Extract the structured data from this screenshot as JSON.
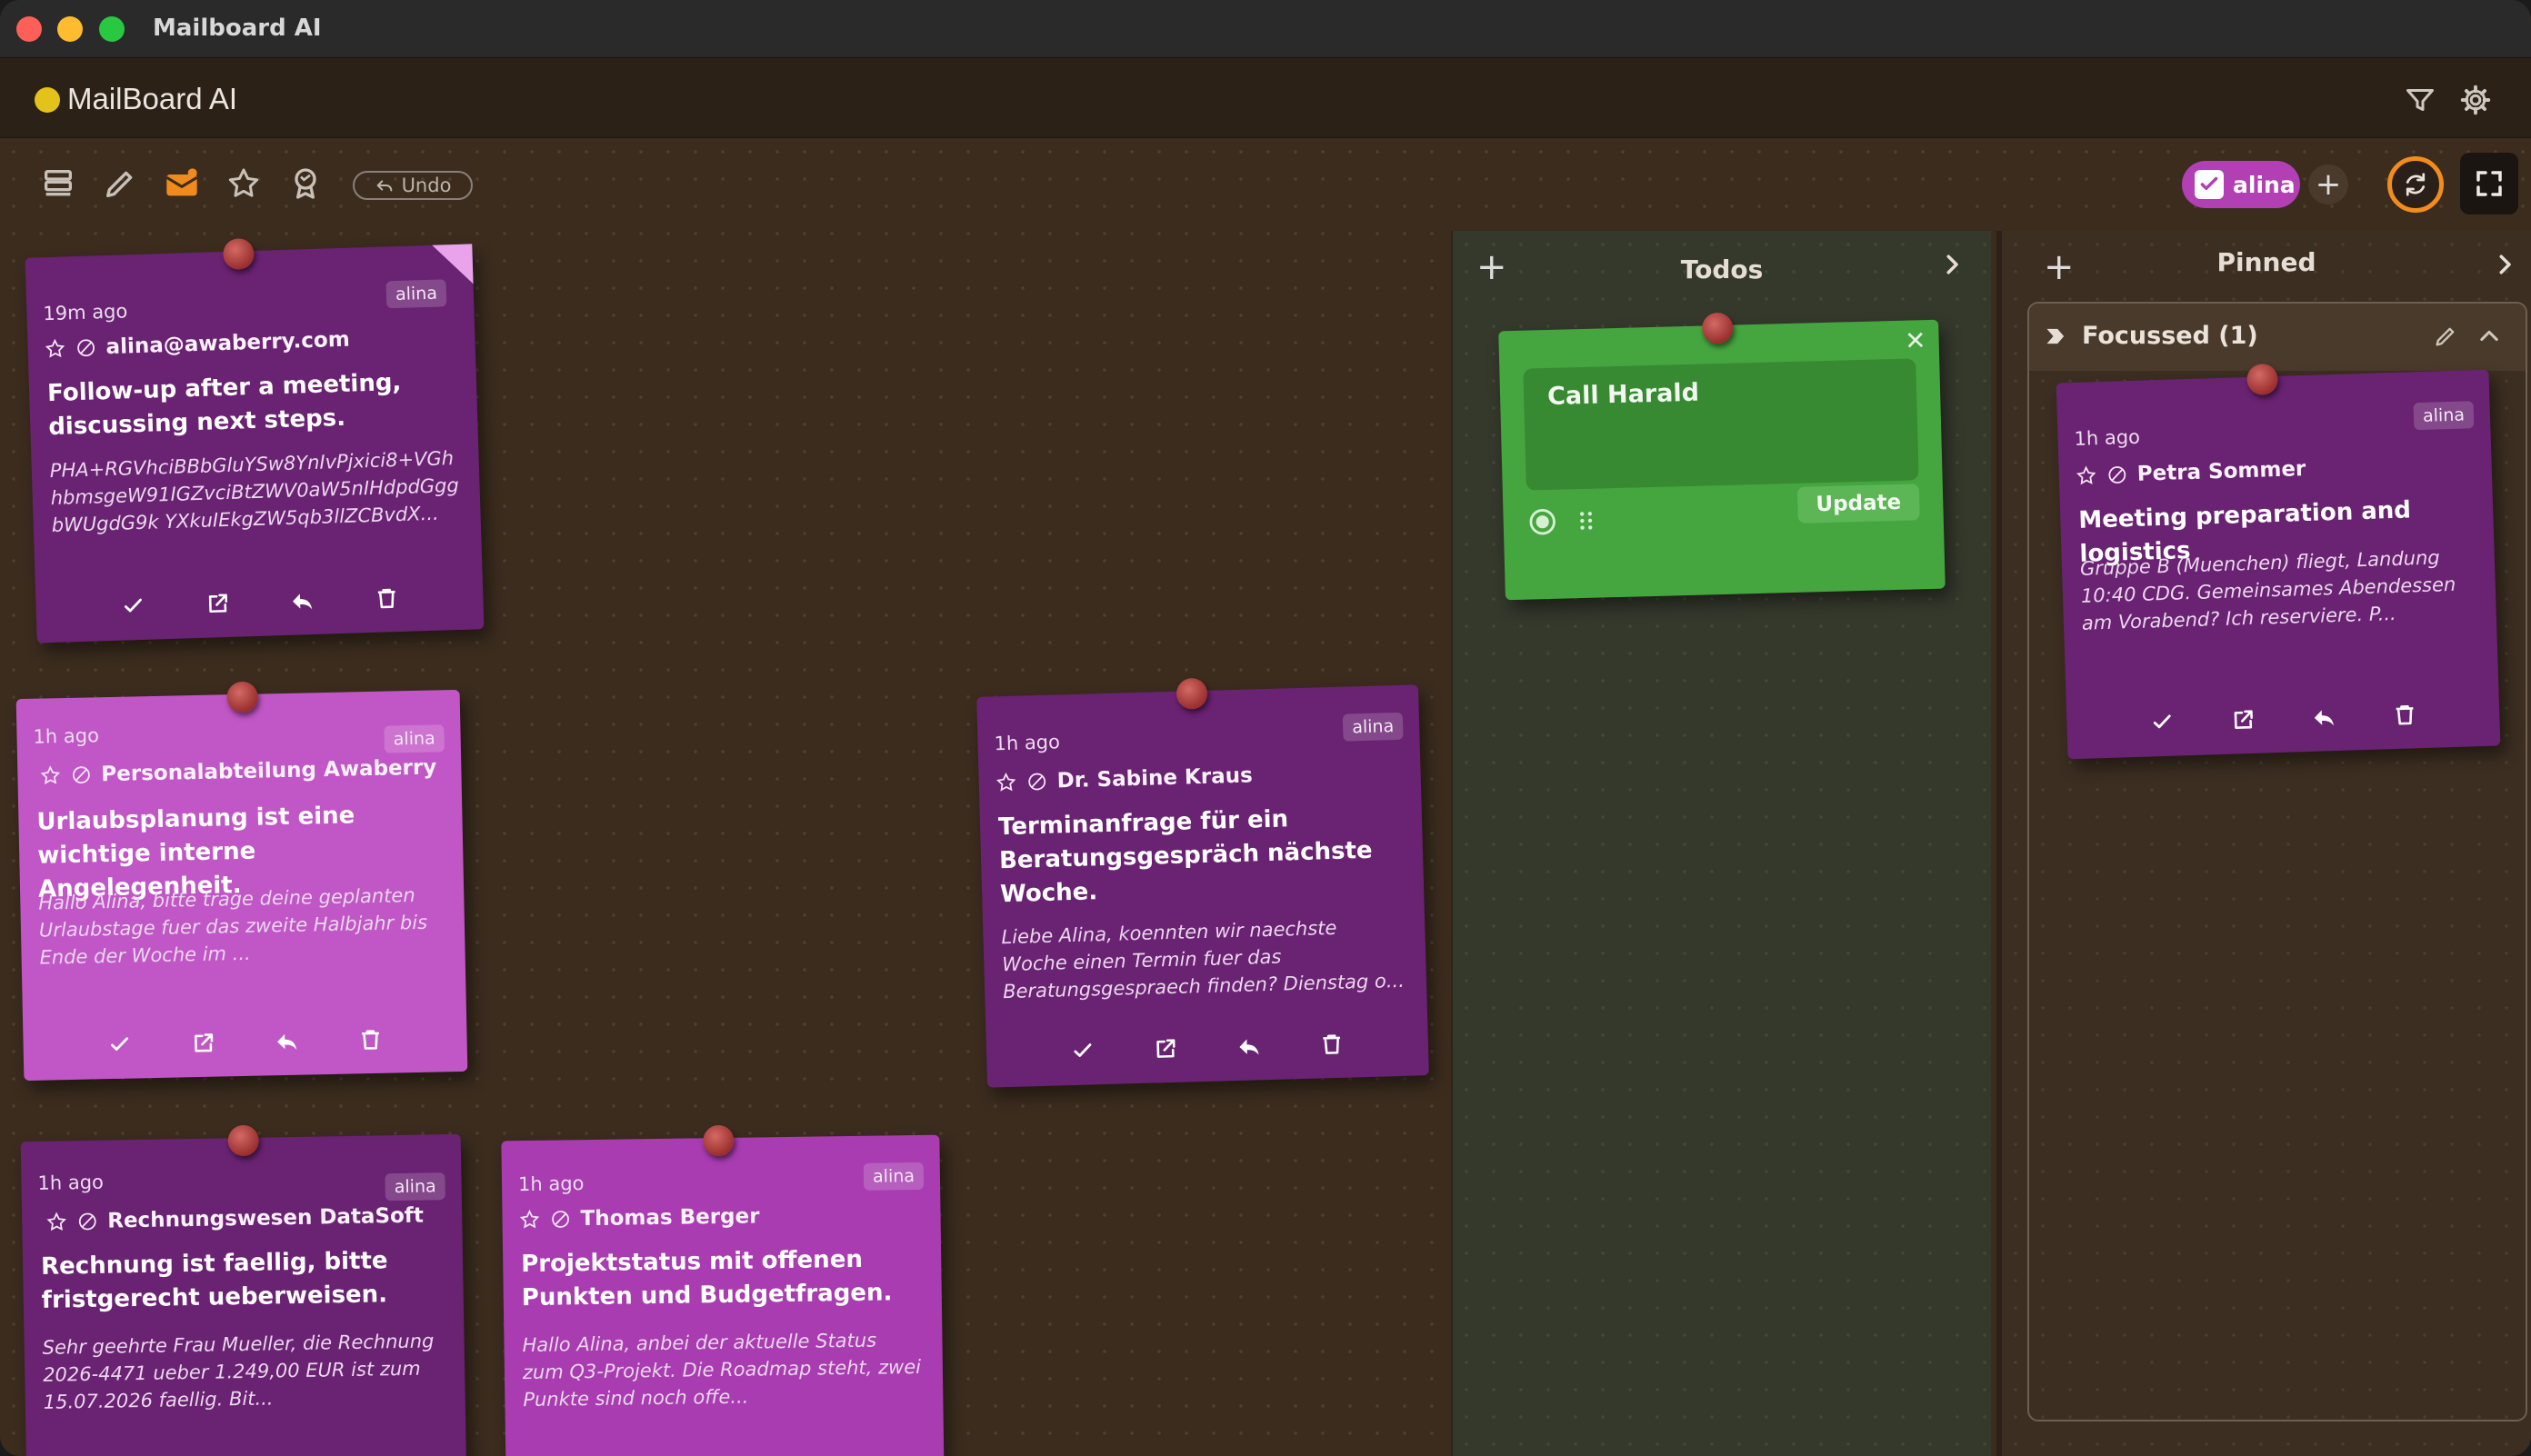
{
  "window": {
    "title": "Mailboard AI"
  },
  "header": {
    "app_title": "MailBoard AI",
    "filter_icon": "filter-icon",
    "settings_icon": "gear-icon"
  },
  "toolbar": {
    "undo_label": "Undo",
    "user_chip": "alina",
    "add_user": "+"
  },
  "columns": {
    "todos": {
      "title": "Todos",
      "plus": "+",
      "chevron": "›"
    },
    "pinned": {
      "title": "Pinned",
      "plus": "+",
      "chevron": "›",
      "group_title": "Focussed (1)"
    }
  },
  "todo": {
    "text": "Call Harald",
    "update_label": "Update",
    "close": "✕"
  },
  "notes": [
    {
      "time": "19m ago",
      "badge": "alina",
      "from": "alina@awaberry.com",
      "subject": "Follow-up after a meeting, discussing next steps.",
      "body": "PHA+RGVhciBBbGluYSw8YnIvPjxici8+VGhhbmsgeW91IGZvciBtZWV0aW5nIHdpdGggbWUgdG9k YXkuIEkgZW5qb3llZCBvdX..."
    },
    {
      "time": "1h ago",
      "badge": "alina",
      "from": "Personalabteilung Awaberry",
      "subject": "Urlaubsplanung ist eine wichtige interne Angelegenheit.",
      "body": "Hallo Alina, bitte trage deine geplanten Urlaubstage fuer das zweite Halbjahr bis Ende der Woche im ..."
    },
    {
      "time": "1h ago",
      "badge": "alina",
      "from": "Dr. Sabine Kraus",
      "subject": "Terminanfrage für ein Beratungsgespräch nächste Woche.",
      "body": "Liebe Alina, koennten wir naechste Woche einen Termin fuer das Beratungsgespraech finden? Dienstag o..."
    },
    {
      "time": "1h ago",
      "badge": "alina",
      "from": "Rechnungswesen DataSoft",
      "subject": "Rechnung ist faellig, bitte fristgerecht ueberweisen.",
      "body": "Sehr geehrte Frau Mueller, die Rechnung 2026-4471 ueber 1.249,00 EUR ist zum 15.07.2026 faellig. Bit..."
    },
    {
      "time": "1h ago",
      "badge": "alina",
      "from": "Thomas Berger",
      "subject": "Projektstatus mit offenen Punkten und Budgetfragen.",
      "body": "Hallo Alina, anbei der aktuelle Status zum Q3-Projekt. Die Roadmap steht, zwei Punkte sind noch offe..."
    },
    {
      "time": "1h ago",
      "badge": "alina",
      "from": "Petra Sommer",
      "subject": "Meeting preparation and logistics",
      "body": "Gruppe B (Muenchen) fliegt, Landung 10:40 CDG. Gemeinsames Abendessen am Vorabend? Ich reserviere. P..."
    }
  ],
  "colors": {
    "note_dark": "#6a2272",
    "note_pink": "#c156c6",
    "note_magenta": "#a83cb0",
    "todo_green": "#45a63f",
    "sync_ring": "#f28d1d",
    "user_chip": "#b23fb3"
  }
}
